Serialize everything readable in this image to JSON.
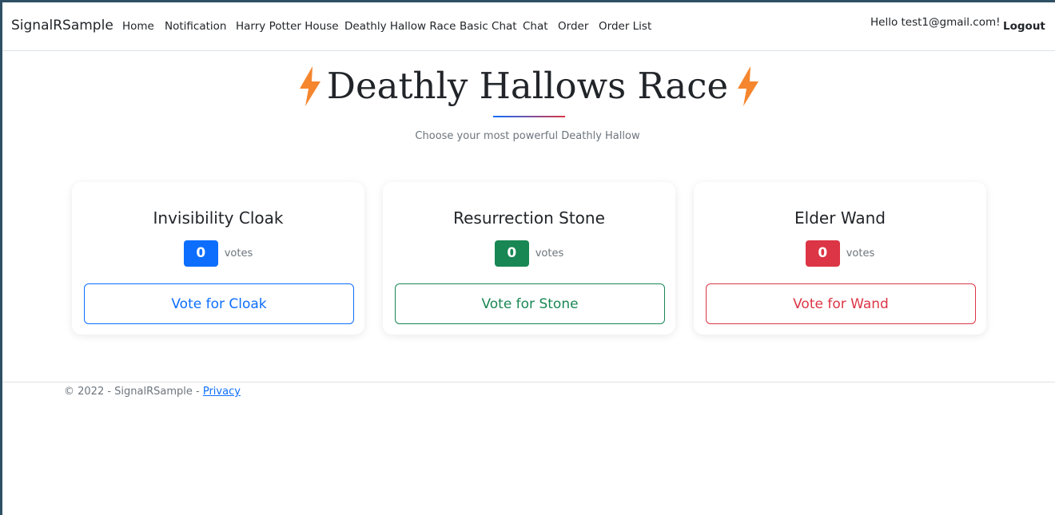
{
  "navbar": {
    "brand": "SignalRSample",
    "items": [
      {
        "label": "Home"
      },
      {
        "label": "Notification"
      },
      {
        "label": "Harry Potter House"
      },
      {
        "label": "Deathly Hallow Race"
      },
      {
        "label": "Basic Chat"
      },
      {
        "label": "Chat"
      },
      {
        "label": "Order"
      },
      {
        "label": "Order List"
      }
    ],
    "greeting": "Hello test1@gmail.com!",
    "logout_label": "Logout"
  },
  "header": {
    "title": "Deathly Hallows Race",
    "subtitle": "Choose your most powerful Deathly Hallow",
    "icon": "lightning-bolt-icon",
    "icon_color": "#f5862e"
  },
  "cards": [
    {
      "title": "Invisibility Cloak",
      "count": "0",
      "votes_label": "votes",
      "button_label": "Vote for Cloak",
      "color": "#0d6efd"
    },
    {
      "title": "Resurrection Stone",
      "count": "0",
      "votes_label": "votes",
      "button_label": "Vote for Stone",
      "color": "#198754"
    },
    {
      "title": "Elder Wand",
      "count": "0",
      "votes_label": "votes",
      "button_label": "Vote for Wand",
      "color": "#dc3545"
    }
  ],
  "footer": {
    "copyright": "© 2022 - SignalRSample - ",
    "privacy_label": "Privacy"
  }
}
